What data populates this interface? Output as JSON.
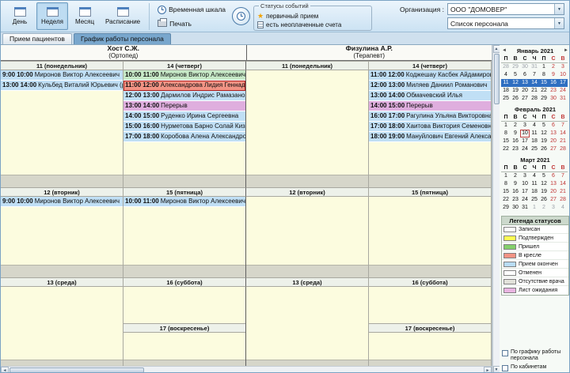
{
  "toolbar": {
    "view_buttons": [
      {
        "id": "day",
        "label": "День",
        "active": false
      },
      {
        "id": "week",
        "label": "Неделя",
        "active": true
      },
      {
        "id": "month",
        "label": "Месяц",
        "active": false
      },
      {
        "id": "schedule",
        "label": "Расписание",
        "active": false
      }
    ],
    "timeline_label": "Временная шкала",
    "print_label": "Печать",
    "statuses_group": {
      "title": "Статусы событий",
      "items": [
        {
          "label": "первичный прием",
          "icon": "star-icon"
        },
        {
          "label": "есть неоплаченные счета",
          "icon": "invoice-icon"
        }
      ]
    },
    "organization_label": "Организация :",
    "organization_value": "ООО \"ДОМОВЕР\"",
    "staff_list_value": "Список персонала"
  },
  "tabs": [
    {
      "label": "Прием пациентов",
      "active": false
    },
    {
      "label": "График работы персонала",
      "active": true
    }
  ],
  "schedule": {
    "staff": [
      {
        "name": "Хост С.Ж.",
        "specialty": "(Ортопед)"
      },
      {
        "name": "Физулина А.Р.",
        "specialty": "(Терапевт)"
      }
    ],
    "bands": [
      {
        "columns": [
          {
            "day": "11 (понедельник)",
            "appointments": [
              {
                "time": "9:00 10:00",
                "name": "Миронов Виктор Алексеевич",
                "status": "finished"
              },
              {
                "time": "13:00 14:00",
                "name": "Кульбед Виталий Юрьевич (ребенок)",
                "status": "finished"
              }
            ]
          },
          {
            "day": "14 (четверг)",
            "appointments": [
              {
                "time": "10:00 11:00",
                "name": "Миронов Виктор Алексеевич",
                "status": "arrived"
              },
              {
                "time": "11:00 12:00",
                "name": "Александрова Лидия Геннадьевна",
                "status": "in-chair",
                "selected": true
              },
              {
                "time": "12:00 13:00",
                "name": "Дармилов Индрис Рамазанович",
                "status": "finished"
              },
              {
                "time": "13:00 14:00",
                "name": "Перерыв",
                "status": "break"
              },
              {
                "time": "14:00 15:00",
                "name": "Руденко Ирина Сергеевна",
                "status": "finished"
              },
              {
                "time": "15:00 16:00",
                "name": "Нурметова Барно Солай Кизи",
                "status": "finished"
              },
              {
                "time": "17:00 18:00",
                "name": "Коробова Алена Александровна",
                "status": "finished"
              }
            ]
          },
          {
            "day": "11 (понедельник)",
            "appointments": []
          },
          {
            "day": "14 (четверг)",
            "appointments": [
              {
                "time": "11:00 12:00",
                "name": "Коджешау Касбек Айдамирович",
                "status": "finished"
              },
              {
                "time": "12:00 13:00",
                "name": "Миляев Даниил Романович",
                "status": "finished"
              },
              {
                "time": "13:00 14:00",
                "name": "Обмачевский Илья",
                "status": "finished"
              },
              {
                "time": "14:00 15:00",
                "name": "Перерыв",
                "status": "break"
              },
              {
                "time": "16:00 17:00",
                "name": "Рагулина Ульяна Викторовна",
                "status": "finished"
              },
              {
                "time": "17:00 18:00",
                "name": "Хаитова Виктория Семеновна",
                "status": "finished"
              },
              {
                "time": "18:00 19:00",
                "name": "Мануйлович Евгений Александрович",
                "status": "finished"
              }
            ]
          }
        ]
      },
      {
        "columns": [
          {
            "day": "12 (вторник)",
            "appointments": [
              {
                "time": "9:00 10:00",
                "name": "Миронов Виктор Алексеевич",
                "status": "finished"
              }
            ]
          },
          {
            "day": "15 (пятница)",
            "appointments": [
              {
                "time": "10:00 11:00",
                "name": "Миронов Виктор Алексеевич",
                "status": "finished"
              }
            ]
          },
          {
            "day": "12 (вторник)",
            "appointments": []
          },
          {
            "day": "15 (пятница)",
            "appointments": []
          }
        ]
      },
      {
        "columns": [
          {
            "day": "13 (среда)",
            "appointments": []
          },
          {
            "day": "16 (суббота)",
            "appointments": [],
            "extra_day": {
              "day": "17 (воскресенье)",
              "appointments": []
            }
          },
          {
            "day": "13 (среда)",
            "appointments": []
          },
          {
            "day": "16 (суббота)",
            "appointments": [],
            "extra_day": {
              "day": "17 (воскресенье)",
              "appointments": []
            }
          }
        ]
      }
    ]
  },
  "mini_calendars": [
    {
      "title": "Январь 2021",
      "day_headers": [
        "П",
        "В",
        "С",
        "Ч",
        "П",
        "С",
        "В"
      ],
      "selected_week": 2,
      "weeks": [
        [
          {
            "d": 28,
            "o": true
          },
          {
            "d": 29,
            "o": true
          },
          {
            "d": 30,
            "o": true
          },
          {
            "d": 31,
            "o": true
          },
          {
            "d": 1
          },
          {
            "d": 2
          },
          {
            "d": 3
          }
        ],
        [
          {
            "d": 4
          },
          {
            "d": 5
          },
          {
            "d": 6
          },
          {
            "d": 7
          },
          {
            "d": 8
          },
          {
            "d": 9
          },
          {
            "d": 10
          }
        ],
        [
          {
            "d": 11
          },
          {
            "d": 12
          },
          {
            "d": 13
          },
          {
            "d": 14
          },
          {
            "d": 15
          },
          {
            "d": 16
          },
          {
            "d": 17
          }
        ],
        [
          {
            "d": 18
          },
          {
            "d": 19
          },
          {
            "d": 20
          },
          {
            "d": 21
          },
          {
            "d": 22
          },
          {
            "d": 23
          },
          {
            "d": 24
          }
        ],
        [
          {
            "d": 25
          },
          {
            "d": 26
          },
          {
            "d": 27
          },
          {
            "d": 28
          },
          {
            "d": 29
          },
          {
            "d": 30
          },
          {
            "d": 31
          }
        ]
      ]
    },
    {
      "title": "Февраль 2021",
      "day_headers": [
        "П",
        "В",
        "С",
        "Ч",
        "П",
        "С",
        "В"
      ],
      "selected_week": -1,
      "weeks": [
        [
          {
            "d": 1
          },
          {
            "d": 2
          },
          {
            "d": 3
          },
          {
            "d": 4
          },
          {
            "d": 5
          },
          {
            "d": 6
          },
          {
            "d": 7
          }
        ],
        [
          {
            "d": 8
          },
          {
            "d": 9
          },
          {
            "d": 10,
            "t": true
          },
          {
            "d": 11
          },
          {
            "d": 12
          },
          {
            "d": 13
          },
          {
            "d": 14
          }
        ],
        [
          {
            "d": 15
          },
          {
            "d": 16
          },
          {
            "d": 17
          },
          {
            "d": 18
          },
          {
            "d": 19
          },
          {
            "d": 20
          },
          {
            "d": 21
          }
        ],
        [
          {
            "d": 22
          },
          {
            "d": 23
          },
          {
            "d": 24
          },
          {
            "d": 25
          },
          {
            "d": 26
          },
          {
            "d": 27
          },
          {
            "d": 28
          }
        ]
      ]
    },
    {
      "title": "Март 2021",
      "day_headers": [
        "П",
        "В",
        "С",
        "Ч",
        "П",
        "С",
        "В"
      ],
      "selected_week": -1,
      "weeks": [
        [
          {
            "d": 1
          },
          {
            "d": 2
          },
          {
            "d": 3
          },
          {
            "d": 4
          },
          {
            "d": 5
          },
          {
            "d": 6
          },
          {
            "d": 7
          }
        ],
        [
          {
            "d": 8
          },
          {
            "d": 9
          },
          {
            "d": 10
          },
          {
            "d": 11
          },
          {
            "d": 12
          },
          {
            "d": 13
          },
          {
            "d": 14
          }
        ],
        [
          {
            "d": 15
          },
          {
            "d": 16
          },
          {
            "d": 17
          },
          {
            "d": 18
          },
          {
            "d": 19
          },
          {
            "d": 20
          },
          {
            "d": 21
          }
        ],
        [
          {
            "d": 22
          },
          {
            "d": 23
          },
          {
            "d": 24
          },
          {
            "d": 25
          },
          {
            "d": 26
          },
          {
            "d": 27
          },
          {
            "d": 28
          }
        ],
        [
          {
            "d": 29
          },
          {
            "d": 30
          },
          {
            "d": 31
          },
          {
            "d": 1,
            "o": true
          },
          {
            "d": 2,
            "o": true
          },
          {
            "d": 3,
            "o": true
          },
          {
            "d": 4,
            "o": true
          }
        ]
      ]
    }
  ],
  "legend": {
    "title": "Легенда статусов",
    "items": [
      {
        "label": "Записан",
        "color": "#ffffff"
      },
      {
        "label": "Подтвержден",
        "color": "#ffff54"
      },
      {
        "label": "Пришел",
        "color": "#84d06c"
      },
      {
        "label": "В кресле",
        "color": "#f29384"
      },
      {
        "label": "Прием окончен",
        "color": "#b8dcf4"
      },
      {
        "label": "Отменен",
        "color": "#ffffff"
      },
      {
        "label": "Отсутствие врача",
        "color": "#e2e2da"
      },
      {
        "label": "Лист ожидания",
        "color": "#eab4e2"
      }
    ]
  },
  "filters": [
    {
      "label": "По графику работы персонала",
      "checked": false
    },
    {
      "label": "По кабинетам",
      "checked": false
    }
  ]
}
